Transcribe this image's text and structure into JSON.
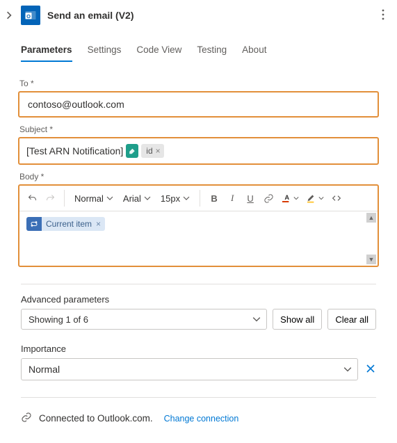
{
  "header": {
    "title": "Send an email (V2)"
  },
  "tabs": {
    "parameters": "Parameters",
    "settings": "Settings",
    "codeview": "Code View",
    "testing": "Testing",
    "about": "About"
  },
  "fields": {
    "to_label": "To *",
    "to_value": "contoso@outlook.com",
    "subject_label": "Subject *",
    "subject_text": "[Test ARN Notification]",
    "subject_token": "id",
    "body_label": "Body *",
    "body_token": "Current item"
  },
  "toolbar": {
    "style": "Normal",
    "font": "Arial",
    "size": "15px"
  },
  "advanced": {
    "label": "Advanced parameters",
    "showing": "Showing 1 of 6",
    "show_all": "Show all",
    "clear_all": "Clear all"
  },
  "importance": {
    "label": "Importance",
    "value": "Normal"
  },
  "connection": {
    "status": "Connected to Outlook.com.",
    "change": "Change connection"
  }
}
